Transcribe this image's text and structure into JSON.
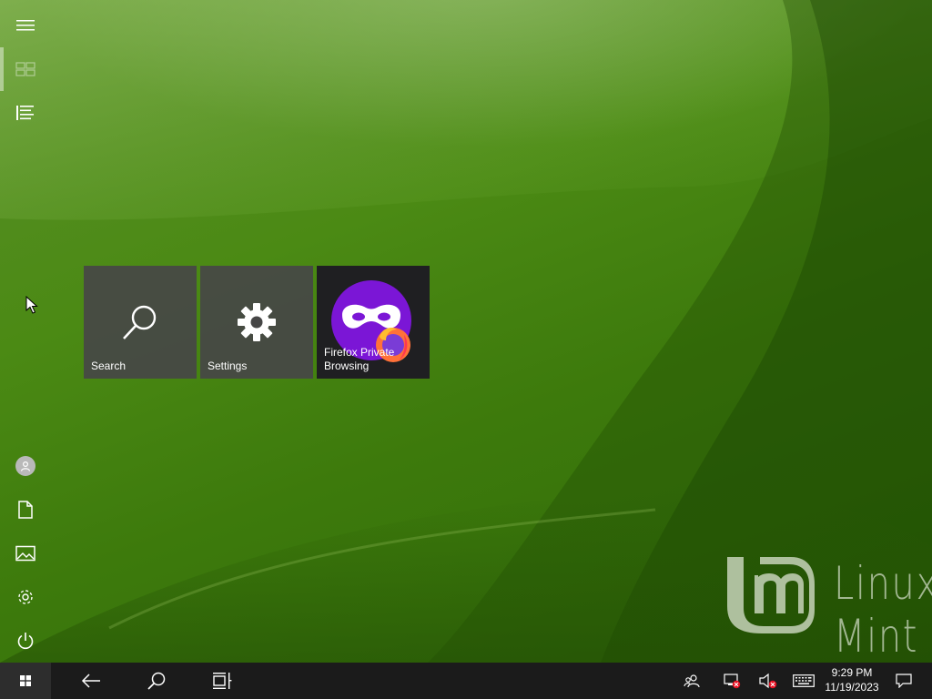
{
  "start_rail": {
    "top_items": [
      {
        "name": "expand-menu",
        "icon": "hamburger-icon"
      },
      {
        "name": "pinned-tiles",
        "icon": "tiles-icon"
      },
      {
        "name": "all-apps",
        "icon": "list-icon"
      }
    ],
    "bottom_items": [
      {
        "name": "user-account",
        "icon": "user-icon"
      },
      {
        "name": "documents",
        "icon": "document-icon"
      },
      {
        "name": "pictures",
        "icon": "picture-icon"
      },
      {
        "name": "settings",
        "icon": "gear-icon"
      },
      {
        "name": "power",
        "icon": "power-icon"
      }
    ]
  },
  "tiles": [
    {
      "label": "Search",
      "icon": "search-icon"
    },
    {
      "label": "Settings",
      "icon": "gear-icon"
    },
    {
      "label": "Firefox Private Browsing",
      "icon": "firefox-private-icon",
      "accent": "#7b16d6"
    }
  ],
  "wallpaper": {
    "brand": "Linux Mint",
    "colors": {
      "base": "#3f7a12",
      "highlight": "#8fbf4f"
    }
  },
  "taskbar": {
    "start_icon": "windows-icon",
    "buttons": [
      {
        "name": "back",
        "icon": "back-arrow-icon"
      },
      {
        "name": "search",
        "icon": "search-icon"
      },
      {
        "name": "task-view",
        "icon": "task-view-icon"
      }
    ],
    "tray": [
      {
        "name": "people",
        "icon": "people-icon"
      },
      {
        "name": "network",
        "icon": "network-disconnected-icon"
      },
      {
        "name": "volume",
        "icon": "volume-muted-icon"
      },
      {
        "name": "keyboard",
        "icon": "keyboard-icon"
      }
    ],
    "clock": {
      "time": "9:29 PM",
      "date": "11/19/2023"
    },
    "notifications_icon": "notification-icon"
  }
}
